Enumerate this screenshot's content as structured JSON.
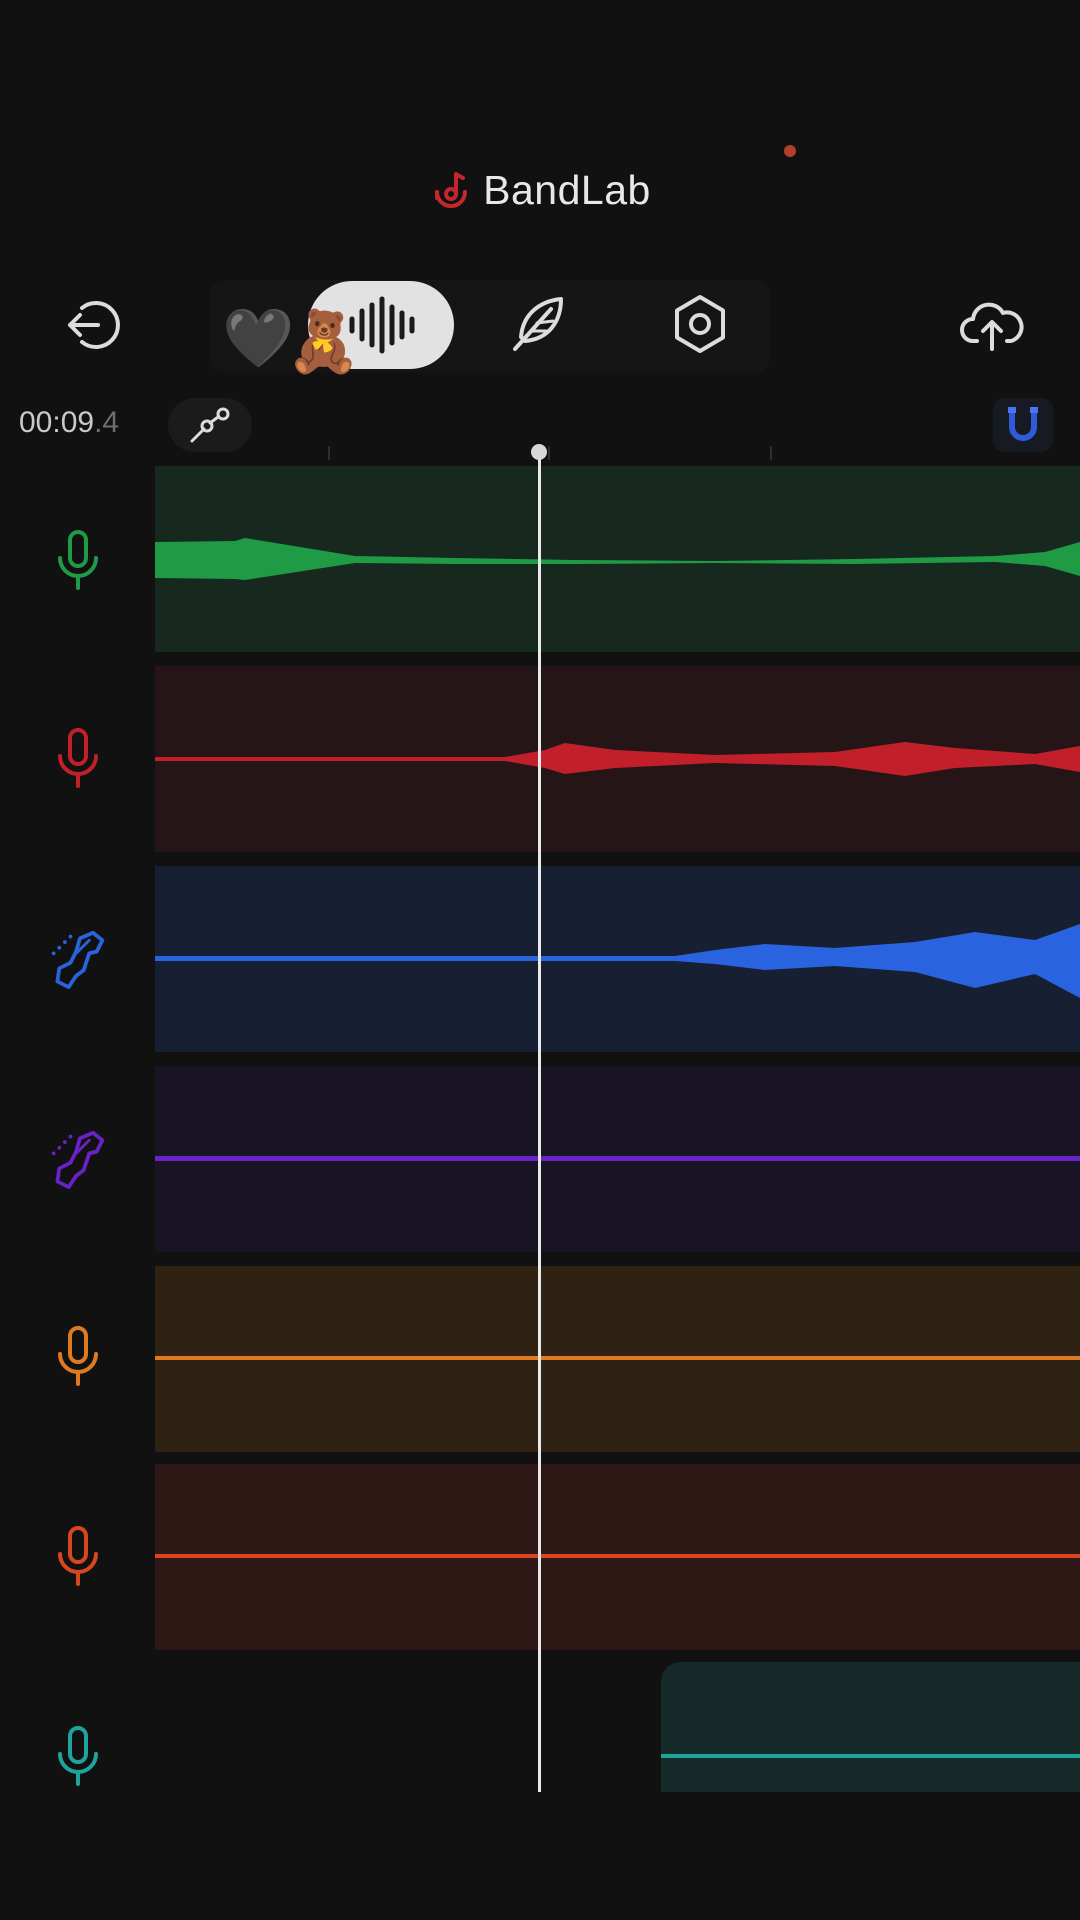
{
  "header": {
    "brand_name": "BandLab",
    "brand_color": "#c2282b",
    "logo_icon": "bandlab-logo-icon",
    "recording_indicator_color": "#b0402a"
  },
  "toolbar": {
    "back_icon": "exit-arrow-icon",
    "emojis": [
      "🖤",
      "🧸"
    ],
    "waveform_icon": "waveform-icon",
    "feather_icon": "feather-icon",
    "settings_icon": "hexagon-settings-icon",
    "upload_icon": "cloud-upload-icon"
  },
  "transport": {
    "time_main": "00:09",
    "time_fraction": ".4",
    "automation_icon": "automation-node-icon",
    "snap_icon": "magnet-snap-icon",
    "snap_color": "#2f5ad8"
  },
  "tracks": [
    {
      "instrument": "microphone-icon",
      "color": "#1f9a45",
      "lane_bg": "#17281f"
    },
    {
      "instrument": "microphone-icon",
      "color": "#c1202a",
      "lane_bg": "#261517"
    },
    {
      "instrument": "electric-guitar-icon",
      "color": "#2a63e0",
      "lane_bg": "#162032"
    },
    {
      "instrument": "electric-guitar-icon",
      "color": "#6a22c8",
      "lane_bg": "#181424"
    },
    {
      "instrument": "microphone-icon",
      "color": "#e07a20",
      "lane_bg": "#302213"
    },
    {
      "instrument": "microphone-icon",
      "color": "#d8451f",
      "lane_bg": "#2e1714"
    },
    {
      "instrument": "microphone-icon",
      "color": "#1fa39a",
      "lane_bg": "#162a29"
    }
  ]
}
